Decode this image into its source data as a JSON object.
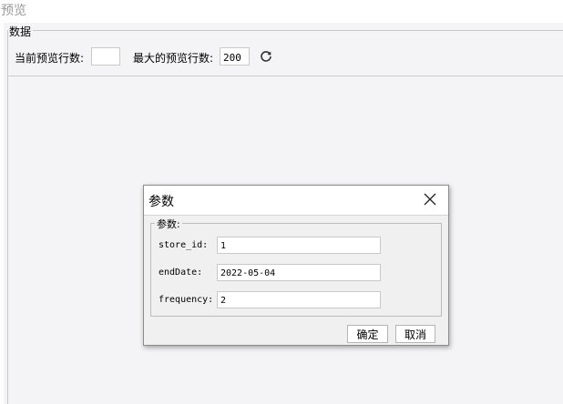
{
  "page": {
    "title": "预览"
  },
  "data_group": {
    "legend": "数据",
    "current_rows_label": "当前预览行数:",
    "current_rows_value": "",
    "max_rows_label": "最大的预览行数:",
    "max_rows_value": "200",
    "refresh_icon": "refresh-icon"
  },
  "dialog": {
    "title": "参数",
    "close_icon": "close-icon",
    "params_legend": "参数:",
    "params": [
      {
        "label": "store_id:",
        "value": "1"
      },
      {
        "label": "endDate:",
        "value": "2022-05-04"
      },
      {
        "label": "frequency:",
        "value": "2"
      }
    ],
    "ok_label": "确定",
    "cancel_label": "取消"
  }
}
